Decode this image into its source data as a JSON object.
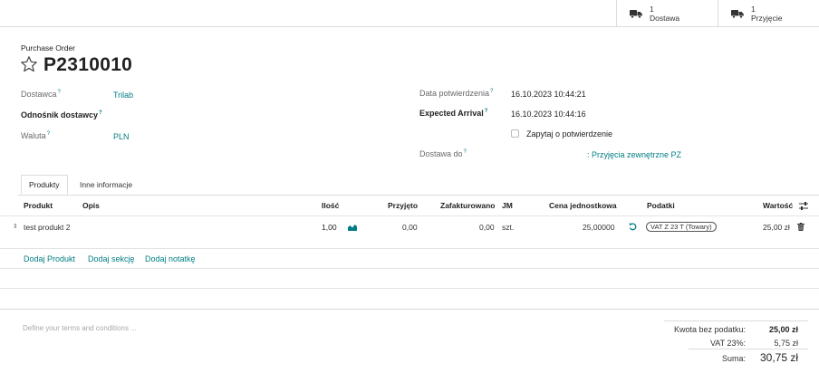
{
  "smart_buttons": [
    {
      "count": "1",
      "label": "Dostawa",
      "icon": "truck-icon"
    },
    {
      "count": "1",
      "label": "Przyjęcie",
      "icon": "truck-icon"
    }
  ],
  "header": {
    "subtitle": "Purchase Order",
    "title": "P2310010"
  },
  "fields_left": {
    "vendor_label": "Dostawca",
    "vendor_value": "Trilab",
    "vendor_ref_label": "Odnośnik dostawcy",
    "currency_label": "Waluta",
    "currency_value": "PLN",
    "help_mark": "?"
  },
  "fields_right": {
    "confirm_date_label": "Data potwierdzenia",
    "confirm_date_value": "16.10.2023 10:44:21",
    "expected_arrival_label": "Expected Arrival",
    "expected_arrival_value": "16.10.2023 10:44:16",
    "ask_confirmation_label": "Zapytaj o potwierdzenie",
    "ask_confirmation_checked": false,
    "deliver_to_label": "Dostawa do",
    "deliver_to_value": ": Przyjęcia zewnętrzne PZ"
  },
  "tabs": [
    {
      "label": "Produkty",
      "active": true
    },
    {
      "label": "Inne informacje",
      "active": false
    }
  ],
  "table": {
    "columns": [
      "Produkt",
      "Opis",
      "Ilość",
      "Przyjęto",
      "Zafakturowano",
      "JM",
      "Cena jednostkowa",
      "Podatki",
      "Wartość"
    ],
    "rows": [
      {
        "product": "test produkt 2",
        "description": "",
        "quantity": "1,00",
        "received": "0,00",
        "invoiced": "0,00",
        "uom": "szt.",
        "unit_price": "25,00000",
        "tax": "VAT Z 23 T (Towary)",
        "subtotal": "25,00 zł"
      }
    ],
    "add_links": [
      "Dodaj Produkt",
      "Dodaj sekcję",
      "Dodaj notatkę"
    ]
  },
  "footer": {
    "terms_placeholder": "Define your terms and conditions ...",
    "untaxed_label": "Kwota bez podatku:",
    "untaxed_value": "25,00 zł",
    "vat_label": "VAT 23%:",
    "vat_value": "5,75 zł",
    "total_label": "Suma:",
    "total_value": "30,75 zł"
  },
  "colors": {
    "link": "#017e84",
    "border": "#dcdcdc"
  }
}
